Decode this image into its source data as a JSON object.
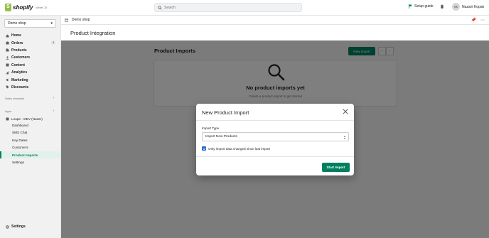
{
  "topbar": {
    "logo_text": "shopify",
    "logo_sub": "Winter '23",
    "search_placeholder": "Search",
    "setup_guide": "Setup guide",
    "user_initials": "NK",
    "user_name": "Nazarii Kopak"
  },
  "sidebar": {
    "shop_name": "Demo shop",
    "nav": [
      {
        "label": "Home",
        "icon": "home-icon"
      },
      {
        "label": "Orders",
        "icon": "orders-icon",
        "badge": "4"
      },
      {
        "label": "Products",
        "icon": "products-icon"
      },
      {
        "label": "Customers",
        "icon": "customers-icon"
      },
      {
        "label": "Content",
        "icon": "content-icon"
      },
      {
        "label": "Analytics",
        "icon": "analytics-icon"
      },
      {
        "label": "Marketing",
        "icon": "marketing-icon"
      },
      {
        "label": "Discounts",
        "icon": "discounts-icon"
      }
    ],
    "sales_channels_label": "Sales channels",
    "apps_label": "Apps",
    "app_name": "Loupe - DEV (Nazar)",
    "app_items": [
      "Dashboard",
      "SMS Chat",
      "Key Dates",
      "Customers",
      "Product Imports",
      "Settings"
    ],
    "active_app_item": "Product Imports",
    "settings_label": "Settings"
  },
  "subbar": {
    "shop_name": "Demo shop"
  },
  "page": {
    "title": "Product Integration",
    "content_title": "Product Imports",
    "new_import_label": "New Import",
    "empty_title": "No product imports yet",
    "empty_subtitle": "Create a product import to get started"
  },
  "modal": {
    "title": "New Product Import",
    "import_type_label": "Import Type",
    "import_type_value": "Import New Products",
    "checkbox_label": "Only import data changed since last import",
    "checkbox_checked": true,
    "start_button": "Start Import"
  },
  "colors": {
    "brand_green": "#008060",
    "checkbox_blue": "#2c6ecb",
    "overlay": "rgba(0,0,0,0.5)"
  }
}
